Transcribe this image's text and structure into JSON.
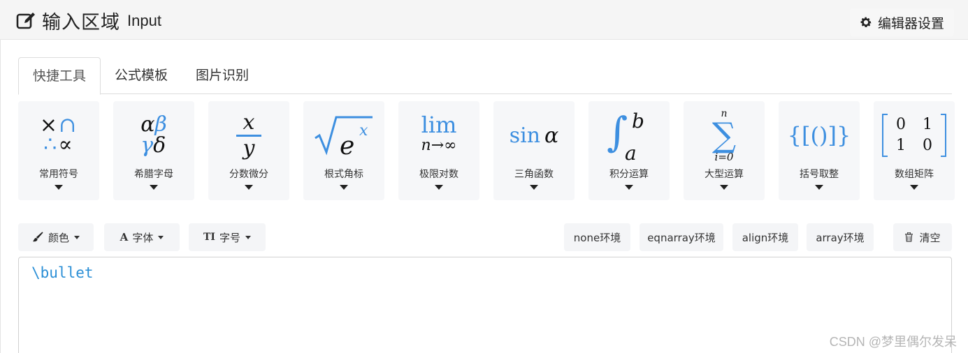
{
  "header": {
    "title_cn": "输入区域",
    "title_en": "Input",
    "settings_label": "编辑器设置"
  },
  "tabs": [
    {
      "label": "快捷工具",
      "active": true
    },
    {
      "label": "公式模板",
      "active": false
    },
    {
      "label": "图片识别",
      "active": false
    }
  ],
  "tools": [
    {
      "label": "常用符号"
    },
    {
      "label": "希腊字母"
    },
    {
      "label": "分数微分"
    },
    {
      "label": "根式角标"
    },
    {
      "label": "极限对数"
    },
    {
      "label": "三角函数"
    },
    {
      "label": "积分运算"
    },
    {
      "label": "大型运算"
    },
    {
      "label": "括号取整"
    },
    {
      "label": "数组矩阵"
    }
  ],
  "tool_symbols": {
    "symbols_row1": "×∩",
    "symbols_row2": "∴∝",
    "greek_1": "α",
    "greek_2": "β",
    "greek_3": "γ",
    "greek_4": "δ",
    "frac_num": "x",
    "frac_den": "y",
    "root_base": "e",
    "root_sup": "x",
    "lim_top": "lim",
    "lim_bottom": "n→∞",
    "trig": "sin",
    "trig_var": "α",
    "int_upper": "b",
    "int_lower": "a",
    "sum_upper": "n",
    "sum_lower": "i=0",
    "bracket": "{[()]}",
    "matrix": [
      "0",
      "1",
      "1",
      "0"
    ]
  },
  "format_toolbar": {
    "color_label": "颜色",
    "font_label": "字体",
    "size_label": "字号",
    "font_icon": "A",
    "size_icon": "TI"
  },
  "env_buttons": [
    "none环境",
    "eqnarray环境",
    "align环境",
    "array环境"
  ],
  "clear_label": "清空",
  "editor": {
    "content": "\\bullet"
  },
  "watermark": "CSDN @梦里偶尔发呆",
  "colors": {
    "accent": "#3d8fe0",
    "code": "#2b8fd6"
  }
}
